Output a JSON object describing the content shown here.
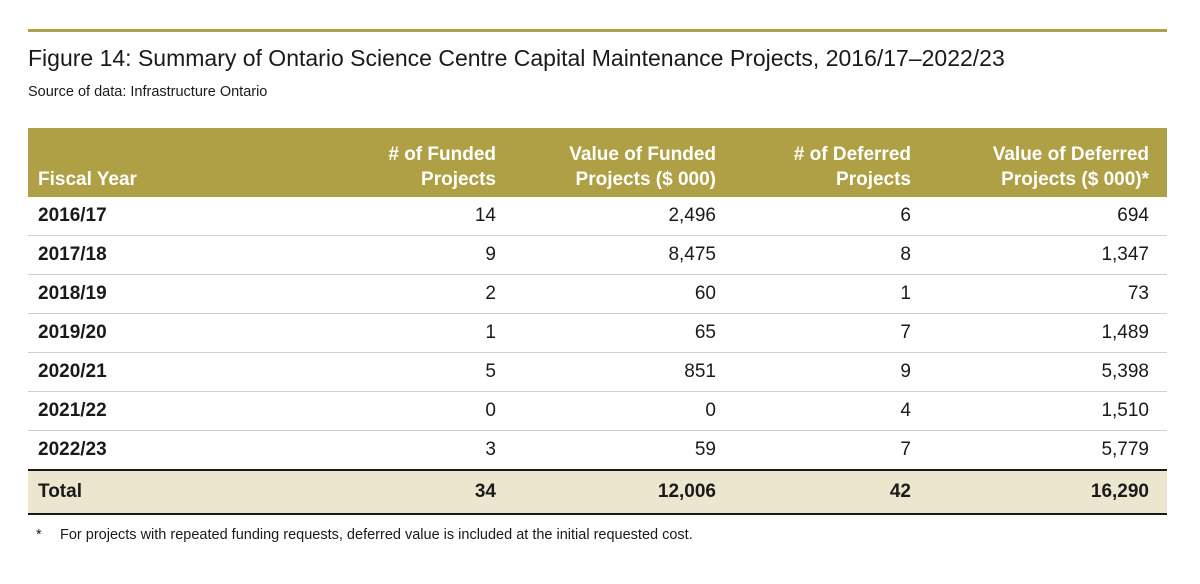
{
  "figure": {
    "title": "Figure 14: Summary of Ontario Science Centre Capital Maintenance Projects, 2016/17–2022/23",
    "source": "Source of data: Infrastructure Ontario",
    "accent_color": "#b0a045",
    "total_row_color": "#ece6cf"
  },
  "table": {
    "headers": [
      [
        "",
        "Fiscal Year"
      ],
      [
        "# of Funded",
        "Projects"
      ],
      [
        "Value of Funded",
        "Projects ($ 000)"
      ],
      [
        "# of Deferred",
        "Projects"
      ],
      [
        "Value of Deferred",
        "Projects ($ 000)*"
      ]
    ],
    "rows": [
      [
        "2016/17",
        "14",
        "2,496",
        "6",
        "694"
      ],
      [
        "2017/18",
        "9",
        "8,475",
        "8",
        "1,347"
      ],
      [
        "2018/19",
        "2",
        "60",
        "1",
        "73"
      ],
      [
        "2019/20",
        "1",
        "65",
        "7",
        "1,489"
      ],
      [
        "2020/21",
        "5",
        "851",
        "9",
        "5,398"
      ],
      [
        "2021/22",
        "0",
        "0",
        "4",
        "1,510"
      ],
      [
        "2022/23",
        "3",
        "59",
        "7",
        "5,779"
      ]
    ],
    "total": [
      "Total",
      "34",
      "12,006",
      "42",
      "16,290"
    ]
  },
  "footnote": {
    "mark": "*",
    "text": "For projects with repeated funding requests, deferred value is included at the initial requested cost."
  }
}
